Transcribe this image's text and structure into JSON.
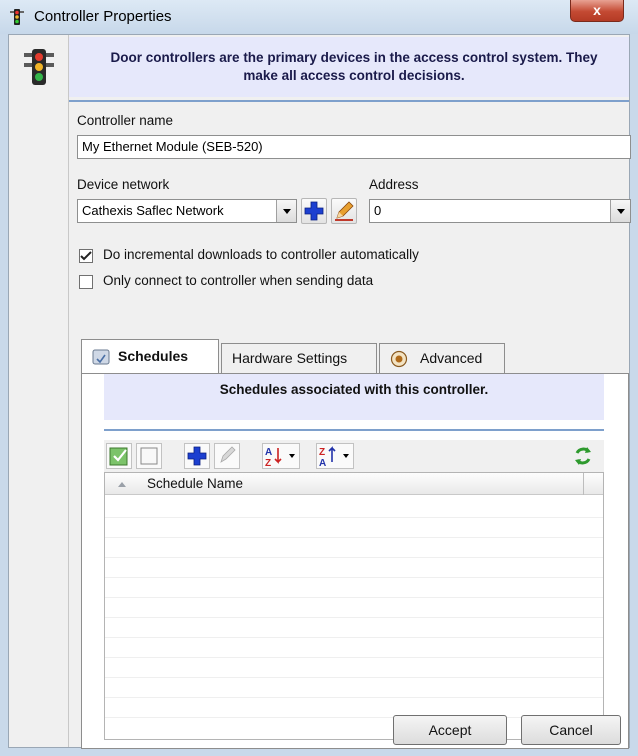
{
  "window": {
    "title": "Controller Properties",
    "close_glyph": "x"
  },
  "header": {
    "text": "Door controllers are the primary devices in the access control system. They make all access control decisions."
  },
  "form": {
    "controller_name_label": "Controller name",
    "controller_name_value": "My Ethernet Module (SEB-520)",
    "device_network_label": "Device network",
    "device_network_value": "Cathexis Saflec Network",
    "address_label": "Address",
    "address_value": "0",
    "incremental_downloads_label": "Do incremental downloads to controller automatically",
    "incremental_downloads_checked": true,
    "only_connect_label": "Only connect to controller when sending data",
    "only_connect_checked": false
  },
  "tabs": [
    {
      "label": "Schedules",
      "icon": "schedule-icon",
      "active": true
    },
    {
      "label": "Hardware Settings",
      "active": false
    },
    {
      "label": "Advanced",
      "icon": "advanced-icon",
      "active": false
    }
  ],
  "schedules": {
    "header_text": "Schedules associated with this controller.",
    "column_header": "Schedule Name",
    "rows": []
  },
  "buttons": {
    "accept": "Accept",
    "cancel": "Cancel"
  },
  "colors": {
    "header_bg": "#e6e8fb",
    "accent_rule": "#7ea0cc",
    "add_blue": "#1c3fd0",
    "refresh_green": "#2e9a2e"
  }
}
